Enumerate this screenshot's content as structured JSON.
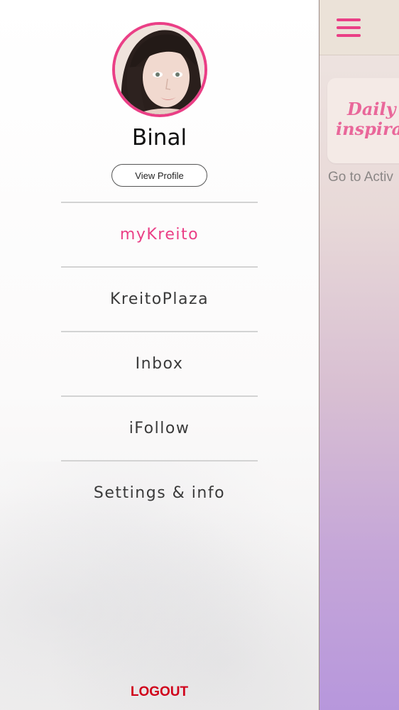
{
  "main": {
    "inspiration_title": "Daily inspiration",
    "go_to_label": "Go to Activ"
  },
  "profile": {
    "name": "Binal",
    "view_profile_label": "View Profile"
  },
  "menu": {
    "items": [
      {
        "label": "myKreito",
        "active": true
      },
      {
        "label": "KreitoPlaza",
        "active": false
      },
      {
        "label": "Inbox",
        "active": false
      },
      {
        "label": "iFollow",
        "active": false
      },
      {
        "label": "Settings & info",
        "active": false
      }
    ]
  },
  "logout_label": "LOGOUT",
  "colors": {
    "accent": "#ea3f86",
    "logout": "#d0021b",
    "menu_text": "#3a3a3a"
  },
  "icons": {
    "menu": "hamburger-icon"
  }
}
